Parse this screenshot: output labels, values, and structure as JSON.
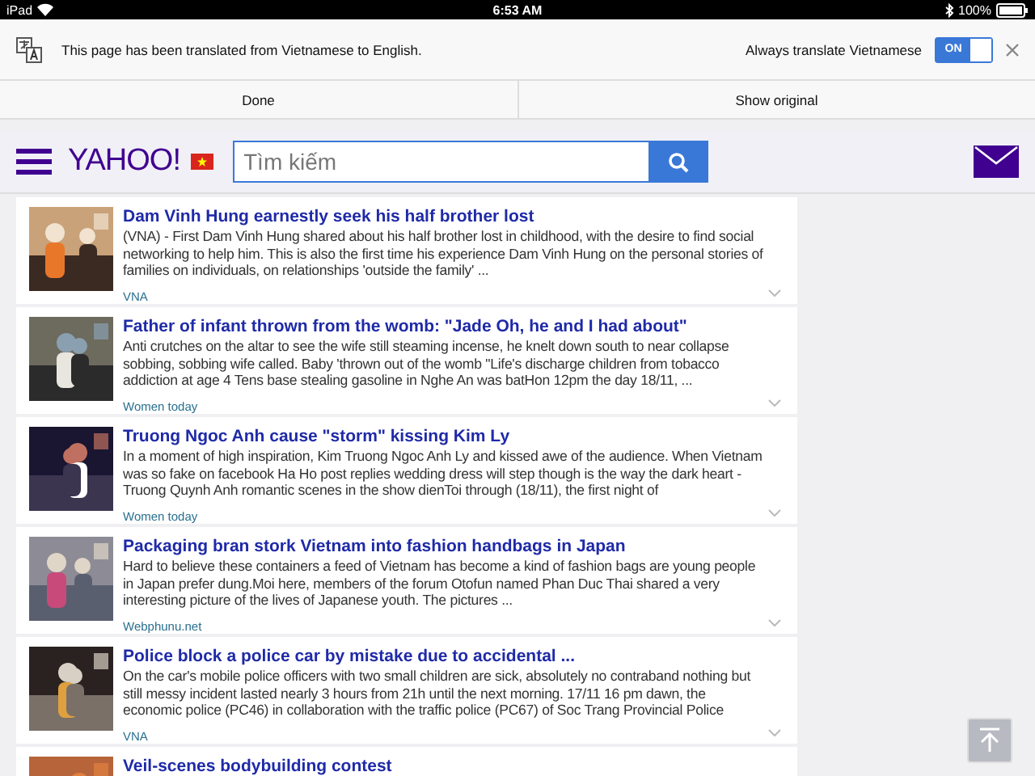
{
  "status_bar": {
    "device": "iPad",
    "time": "6:53 AM",
    "battery": "100%"
  },
  "translate_bar": {
    "message": "This page has been translated from Vietnamese to English.",
    "always_label": "Always translate Vietnamese",
    "always_toggle": {
      "label": "ON",
      "on": true
    },
    "buttons": [
      "Done",
      "Show original"
    ]
  },
  "header": {
    "logo": "YAHOO!",
    "search": {
      "placeholder": "Tìm kiếm"
    }
  },
  "articles": [
    {
      "title": "Dam Vinh Hung earnestly seek his half brother lost",
      "body": "(VNA) - First Dam Vinh Hung shared about his half brother lost in childhood, with the desire to find social networking to help him. This is also the first time his experience Dam Vinh Hung on the personal stories of families on individuals, on relationships 'outside the family' ...",
      "source": "VNA"
    },
    {
      "title": "Father of infant thrown from the womb: \"Jade Oh, he and I had about\"",
      "body": "Anti crutches on the altar to see the wife still steaming incense, he knelt down south to near collapse sobbing, sobbing wife called. Baby 'thrown out of the womb \"Life's discharge children from tobacco addiction at age 4 Tens base stealing gasoline in Nghe An was batHon 12pm the day 18/11, ...",
      "source": "Women today"
    },
    {
      "title": "Truong Ngoc Anh cause \"storm\" kissing Kim Ly",
      "body": "In a moment of high inspiration, Kim Truong Ngoc Anh Ly and kissed awe of the audience. When Vietnam was so fake on facebook Ha Ho post replies wedding dress will step though is the way the dark heart - Truong Quynh Anh romantic scenes in the show dienToi through (18/11), the first night of",
      "source": "Women today"
    },
    {
      "title": "Packaging bran stork Vietnam into fashion handbags in Japan",
      "body": "Hard to believe these containers a feed of Vietnam has become a kind of fashion bags are young people in Japan prefer dung.Moi here, members of the forum Otofun named Phan Duc Thai shared a very interesting picture of the lives of Japanese youth. The pictures ...",
      "source": "Webphunu.net"
    },
    {
      "title": "Police block a police car by mistake due to accidental ...",
      "body": "On the car's mobile police officers with two small children are sick, absolutely no contraband nothing but still messy incident lasted nearly 3 hours from 21h until the next morning. 17/11 16 pm dawn, the economic police (PC46) in collaboration with the traffic police (PC67) of Soc Trang Provincial Police",
      "source": "VNA"
    },
    {
      "title": "Veil-scenes bodybuilding contest"
    }
  ]
}
